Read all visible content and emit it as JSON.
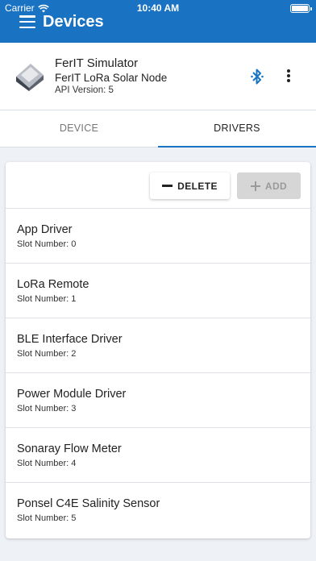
{
  "status_bar": {
    "carrier": "Carrier",
    "time": "10:40 AM"
  },
  "header": {
    "title": "Devices"
  },
  "device": {
    "name": "FerIT Simulator",
    "model": "FerIT LoRa Solar Node",
    "api_version": "API Version: 5"
  },
  "tabs": [
    {
      "label": "DEVICE",
      "active": false
    },
    {
      "label": "DRIVERS",
      "active": true
    }
  ],
  "actions": {
    "delete_label": "DELETE",
    "add_label": "ADD"
  },
  "drivers": [
    {
      "name": "App Driver",
      "slot": "Slot Number: 0"
    },
    {
      "name": "LoRa Remote",
      "slot": "Slot Number: 1"
    },
    {
      "name": "BLE Interface Driver",
      "slot": "Slot Number: 2"
    },
    {
      "name": "Power Module Driver",
      "slot": "Slot Number: 3"
    },
    {
      "name": "Sonaray Flow Meter",
      "slot": "Slot Number: 4"
    },
    {
      "name": "Ponsel C4E Salinity Sensor",
      "slot": "Slot Number: 5"
    }
  ],
  "colors": {
    "primary": "#1a73c2",
    "background": "#eef1f5",
    "disabled": "#d6d6d6"
  },
  "icons": [
    "wifi-icon",
    "battery-icon",
    "menu-icon",
    "device-icon",
    "bluetooth-icon",
    "more-vert-icon",
    "minus-icon",
    "plus-icon"
  ]
}
